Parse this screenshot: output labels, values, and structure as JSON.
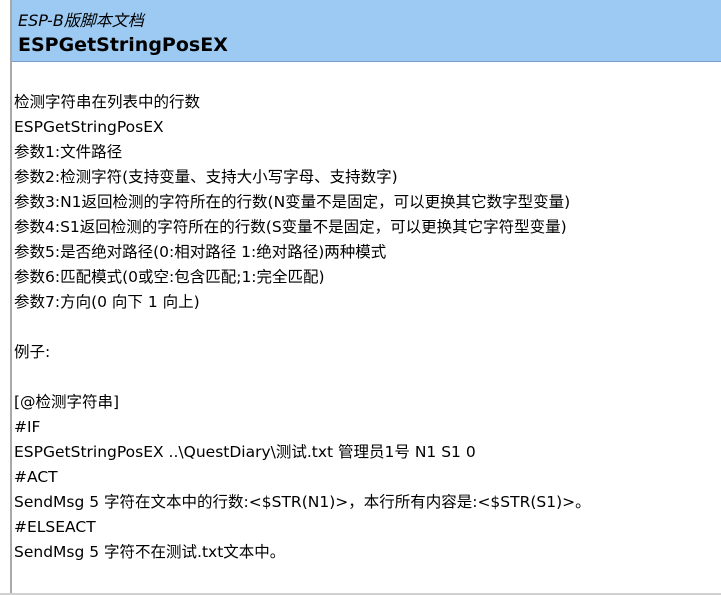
{
  "header": {
    "subtitle": "ESP-B版脚本文档",
    "title": "ESPGetStringPosEX"
  },
  "description": {
    "summary": "检测字符串在列表中的行数",
    "command": "ESPGetStringPosEX",
    "params": [
      "参数1:文件路径",
      "参数2:检测字符(支持变量、支持大小写字母、支持数字)",
      "参数3:N1返回检测的字符所在的行数(N变量不是固定，可以更换其它数字型变量)",
      "参数4:S1返回检测的字符所在的行数(S变量不是固定，可以更换其它字符型变量)",
      "参数5:是否绝对路径(0:相对路径 1:绝对路径)两种模式",
      "参数6:匹配模式(0或空:包含匹配;1:完全匹配)",
      "参数7:方向(0 向下 1 向上)"
    ]
  },
  "example": {
    "label": "例子:",
    "lines": [
      "[@检测字符串]",
      "#IF",
      "ESPGetStringPosEX ..\\QuestDiary\\测试.txt 管理员1号 N1 S1 0",
      "#ACT",
      "SendMsg 5 字符在文本中的行数:<$STR(N1)>，本行所有内容是:<$STR(S1)>。",
      "#ELSEACT",
      "SendMsg 5 字符不在测试.txt文本中。"
    ]
  }
}
